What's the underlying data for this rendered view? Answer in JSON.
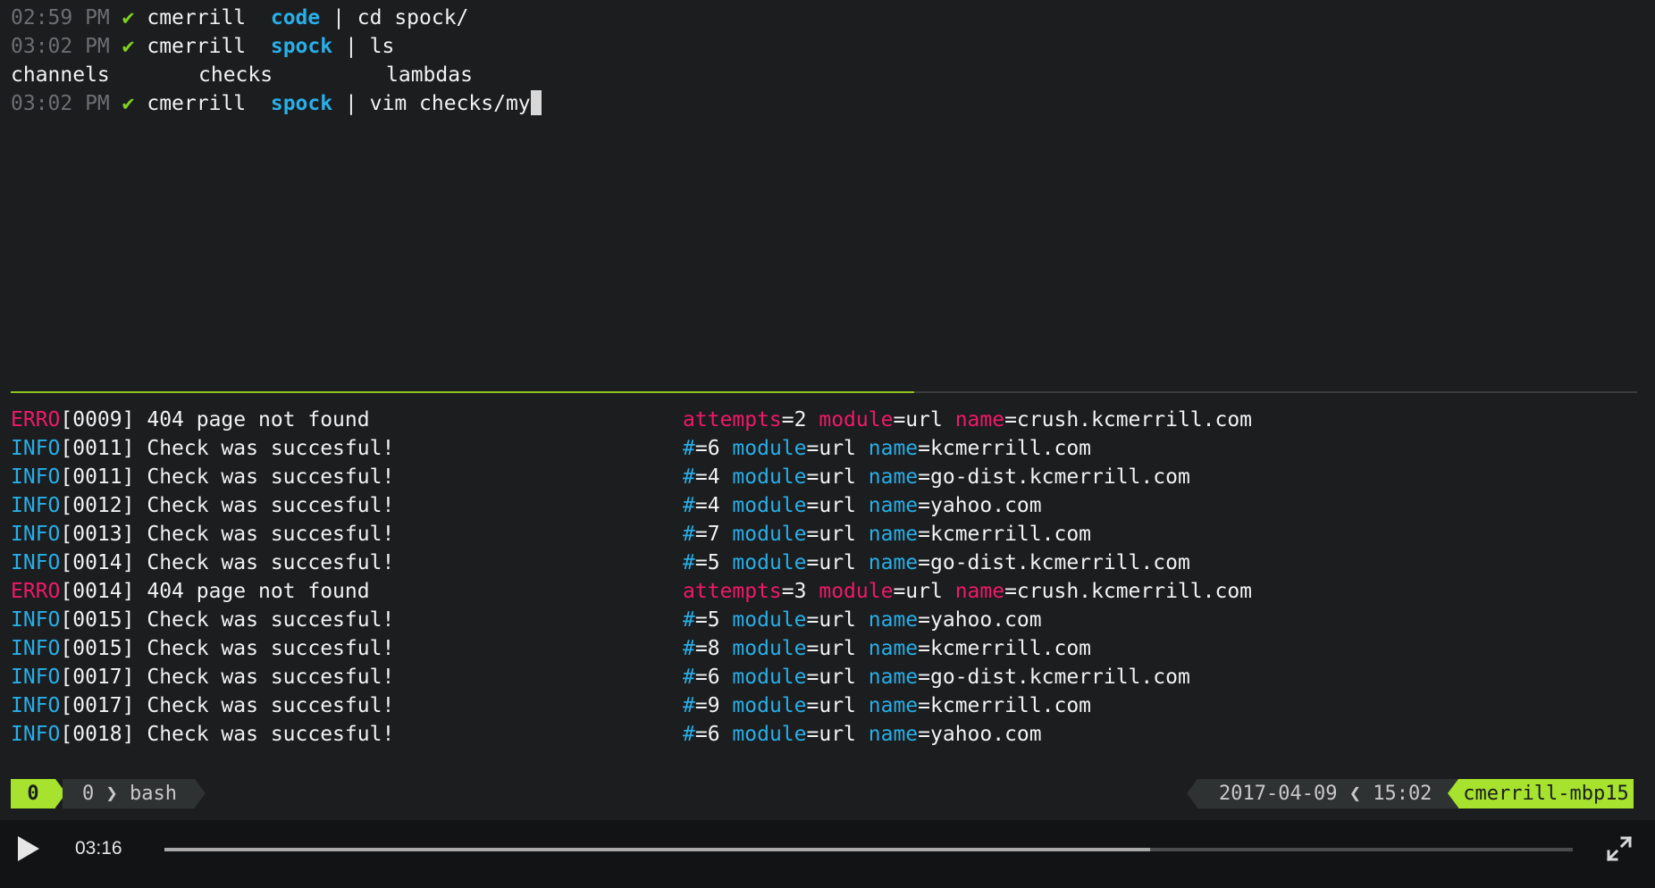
{
  "shell": {
    "lines": [
      {
        "time": "02:59 PM",
        "check": "✔",
        "user": "cmerrill",
        "dir": "code",
        "cmd": "cd spock/"
      },
      {
        "time": "03:02 PM",
        "check": "✔",
        "user": "cmerrill",
        "dir": "spock",
        "cmd": "ls"
      },
      {
        "time": "03:02 PM",
        "check": "✔",
        "user": "cmerrill",
        "dir": "spock",
        "cmd": "vim checks/my"
      }
    ],
    "ls_output": [
      "channels",
      "checks",
      "lambdas"
    ]
  },
  "logs": [
    {
      "level": "ERRO",
      "num": "[0009]",
      "msg": "404 page not found",
      "k1": "attempts",
      "v1": "=2",
      "v2": "=url",
      "v3": "=crush.kcmerrill.com"
    },
    {
      "level": "INFO",
      "num": "[0011]",
      "msg": "Check was succesful!",
      "k1": "#",
      "v1": "=6",
      "v2": "=url",
      "v3": "=kcmerrill.com"
    },
    {
      "level": "INFO",
      "num": "[0011]",
      "msg": "Check was succesful!",
      "k1": "#",
      "v1": "=4",
      "v2": "=url",
      "v3": "=go-dist.kcmerrill.com"
    },
    {
      "level": "INFO",
      "num": "[0012]",
      "msg": "Check was succesful!",
      "k1": "#",
      "v1": "=4",
      "v2": "=url",
      "v3": "=yahoo.com"
    },
    {
      "level": "INFO",
      "num": "[0013]",
      "msg": "Check was succesful!",
      "k1": "#",
      "v1": "=7",
      "v2": "=url",
      "v3": "=kcmerrill.com"
    },
    {
      "level": "INFO",
      "num": "[0014]",
      "msg": "Check was succesful!",
      "k1": "#",
      "v1": "=5",
      "v2": "=url",
      "v3": "=go-dist.kcmerrill.com"
    },
    {
      "level": "ERRO",
      "num": "[0014]",
      "msg": "404 page not found",
      "k1": "attempts",
      "v1": "=3",
      "v2": "=url",
      "v3": "=crush.kcmerrill.com"
    },
    {
      "level": "INFO",
      "num": "[0015]",
      "msg": "Check was succesful!",
      "k1": "#",
      "v1": "=5",
      "v2": "=url",
      "v3": "=yahoo.com"
    },
    {
      "level": "INFO",
      "num": "[0015]",
      "msg": "Check was succesful!",
      "k1": "#",
      "v1": "=8",
      "v2": "=url",
      "v3": "=kcmerrill.com"
    },
    {
      "level": "INFO",
      "num": "[0017]",
      "msg": "Check was succesful!",
      "k1": "#",
      "v1": "=6",
      "v2": "=url",
      "v3": "=go-dist.kcmerrill.com"
    },
    {
      "level": "INFO",
      "num": "[0017]",
      "msg": "Check was succesful!",
      "k1": "#",
      "v1": "=9",
      "v2": "=url",
      "v3": "=kcmerrill.com"
    },
    {
      "level": "INFO",
      "num": "[0018]",
      "msg": "Check was succesful!",
      "k1": "#",
      "v1": "=6",
      "v2": "=url",
      "v3": "=yahoo.com"
    }
  ],
  "log_keys": {
    "module": "module",
    "name": "name"
  },
  "statusbar": {
    "session": "0",
    "window_index": "0",
    "chevron": "❯",
    "window_name": "bash",
    "date": "2017-04-09",
    "date_sep": "❮",
    "time": "15:02",
    "host": "cmerrill-mbp15"
  },
  "player": {
    "timecode": "03:16",
    "progress": 0.7,
    "play_icon": "play-icon",
    "fullscreen_icon": "fullscreen-icon"
  },
  "colors": {
    "accent_green": "#a6e22e",
    "info_blue": "#29aee8",
    "error_pink": "#f0196a"
  }
}
